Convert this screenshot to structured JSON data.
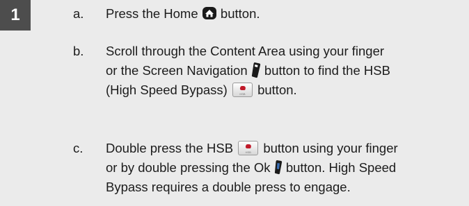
{
  "step_number": "1",
  "steps": [
    {
      "letter": "a.",
      "part1": "Press the Home",
      "part2": "button."
    },
    {
      "letter": "b.",
      "line1": "Scroll through the Content Area using your finger",
      "line2_part1": "or the Screen Navigation",
      "line2_part2": "button to find the HSB",
      "line3_part1": "(High Speed Bypass)",
      "line3_part2": "button."
    },
    {
      "letter": "c.",
      "line1_part1": "Double press the HSB",
      "line1_part2": "button using your finger",
      "line2_part1": "or by double pressing the Ok",
      "line2_part2": "button. High Speed",
      "line3": "Bypass requires a double press to engage."
    }
  ],
  "icons": {
    "home": "home-icon",
    "screen_navigation": "screen-navigation-icon",
    "hsb": "hsb-button-icon",
    "ok": "ok-button-icon"
  },
  "hsb_icon_label": "HSB",
  "colors": {
    "background": "#ebebeb",
    "badge": "#4d4d4d",
    "text": "#1c1c1c",
    "hsb_mark": "#c01a2a"
  }
}
